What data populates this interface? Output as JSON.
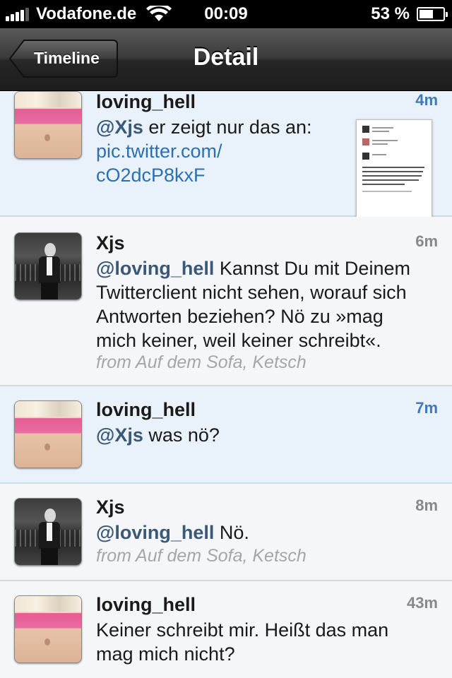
{
  "status_bar": {
    "carrier": "Vodafone.de",
    "time": "00:09",
    "battery": "53 %"
  },
  "nav": {
    "back_label": "Timeline",
    "title": "Detail"
  },
  "tweets": [
    {
      "username": "loving_hell",
      "time": "4m",
      "mention": "@Xjs",
      "text_line1": " er zeigt nur das an:",
      "link_line1": "pic.twitter.com/",
      "link_line2": "cO2dcP8kxF"
    },
    {
      "username": "Xjs",
      "time": "6m",
      "mention": "@loving_hell",
      "text_line1": " Kannst Du mit Deinem",
      "text_line2": "Twitterclient nicht sehen, worauf sich",
      "text_line3": "Antworten beziehen? Nö zu »mag",
      "text_line4": "mich keiner, weil keiner schreibt«.",
      "source": "from Auf dem Sofa, Ketsch"
    },
    {
      "username": "loving_hell",
      "time": "7m",
      "mention": "@Xjs",
      "text_line1": " was nö?"
    },
    {
      "username": "Xjs",
      "time": "8m",
      "mention": "@loving_hell",
      "text_line1": " Nö.",
      "source": "from Auf dem Sofa, Ketsch"
    },
    {
      "username": "loving_hell",
      "time": "43m",
      "text_line1": "Keiner schreibt mir. Heißt das man",
      "text_line2": "mag mich nicht?"
    }
  ],
  "colors": {
    "mention_bg": "#e9f1fa",
    "normal_bg": "#f5f6f7",
    "link": "#2b6fb4",
    "mention_time": "#3f7ab7"
  },
  "icons": {
    "signal": "signal-bars-icon",
    "wifi": "wifi-icon",
    "battery": "battery-icon",
    "back": "back-arrow-button"
  }
}
